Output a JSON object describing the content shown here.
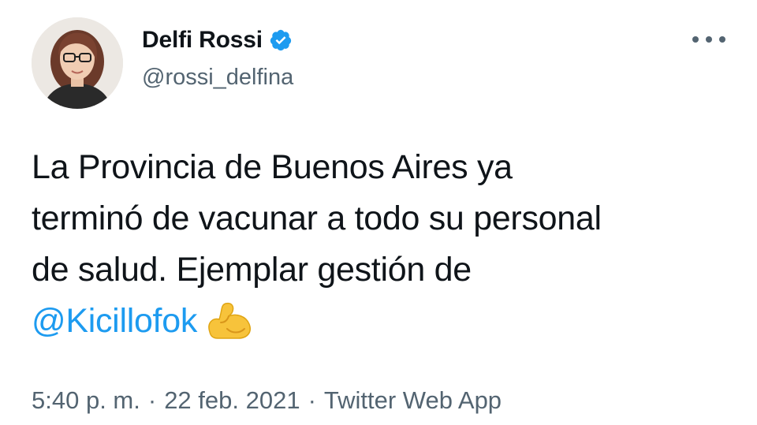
{
  "author": {
    "display_name": "Delfi Rossi",
    "handle": "@rossi_delfina",
    "verified": true,
    "avatar_icon": "profile-photo"
  },
  "tweet": {
    "line1": "La Provincia de Buenos Aires ya",
    "line2": "terminó de vacunar a todo su personal",
    "line3": "de salud. Ejemplar gestión de",
    "mention": "@Kicillofok",
    "emoji_icon": "flexed-biceps-icon"
  },
  "meta": {
    "time": "5:40 p. m.",
    "separator": "·",
    "date": "22 feb. 2021",
    "source": "Twitter Web App"
  },
  "colors": {
    "link": "#1d9bf0",
    "text": "#0f1419",
    "secondary": "#536471",
    "verified_badge": "#1d9bf0"
  }
}
